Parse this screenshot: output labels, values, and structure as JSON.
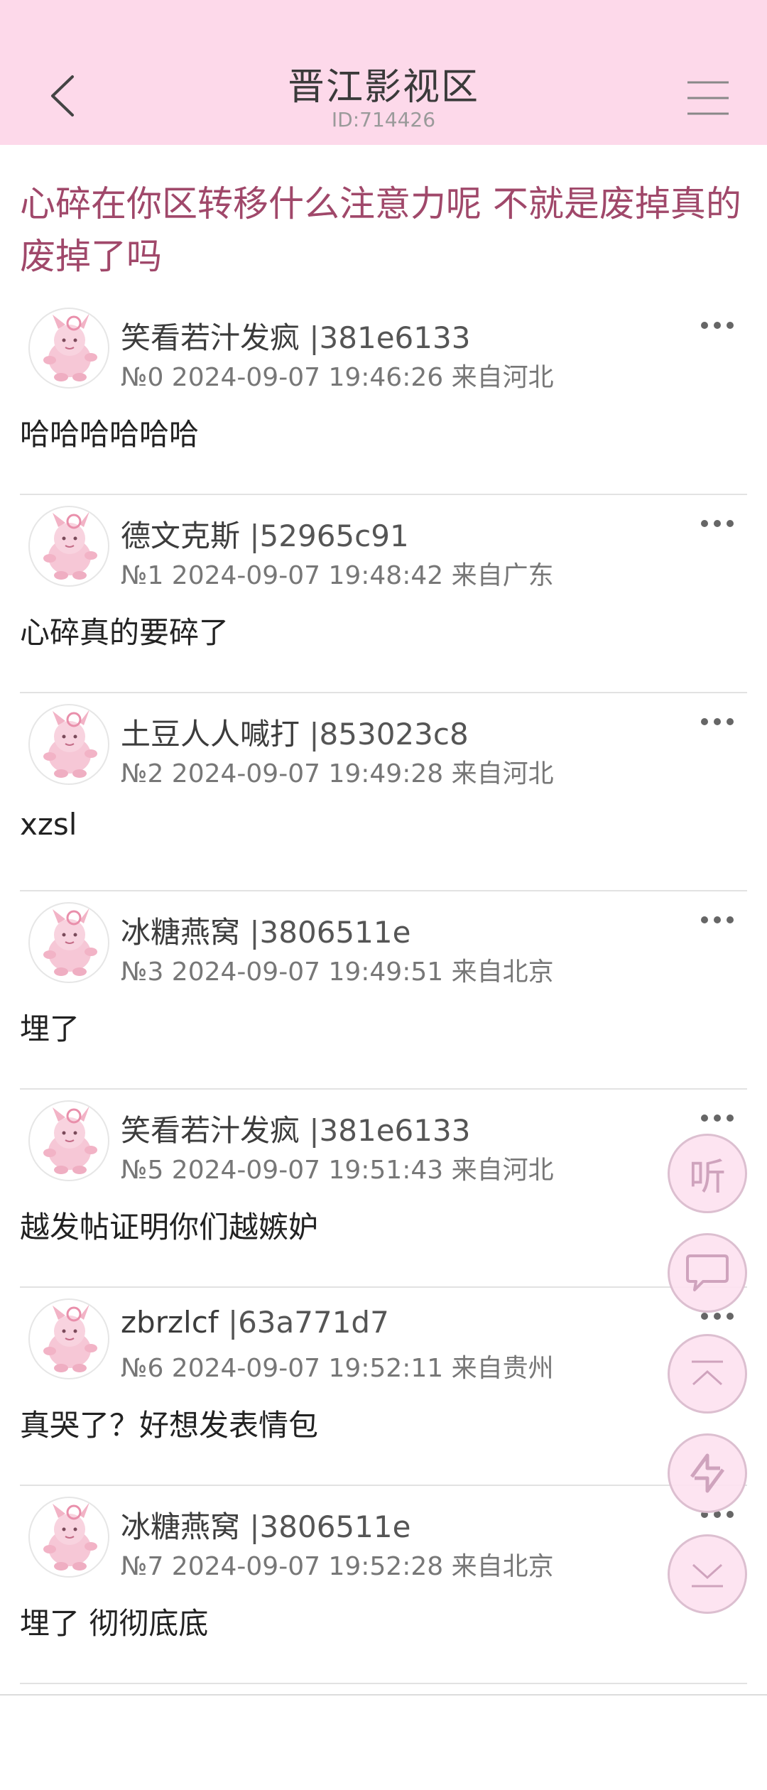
{
  "header": {
    "title": "晋江影视区",
    "id_label": "ID:714426",
    "background": "#fdd9ea"
  },
  "thread": {
    "title": "心碎在你区转移什么注意力呢 不就是废掉真的废掉了吗",
    "title_color": "#a0486a"
  },
  "posts": [
    {
      "author": "笑看若汁发疯",
      "uid": "|381e6133",
      "meta": "№0 2024-09-07 19:46:26 来自河北",
      "body": "哈哈哈哈哈哈"
    },
    {
      "author": "德文克斯",
      "uid": "|52965c91",
      "meta": "№1 2024-09-07 19:48:42 来自广东",
      "body": "心碎真的要碎了"
    },
    {
      "author": "土豆人人喊打",
      "uid": "|853023c8",
      "meta": "№2 2024-09-07 19:49:28 来自河北",
      "body": "xzsl"
    },
    {
      "author": "冰糖燕窝",
      "uid": "|3806511e",
      "meta": "№3 2024-09-07 19:49:51 来自北京",
      "body": "埋了"
    },
    {
      "author": "笑看若汁发疯",
      "uid": "|381e6133",
      "meta": "№5 2024-09-07 19:51:43 来自河北",
      "body": "越发帖证明你们越嫉妒"
    },
    {
      "author": "zbrzlcf",
      "uid": "|63a771d7",
      "meta": "№6 2024-09-07 19:52:11 来自贵州",
      "body": "真哭了？好想发表情包"
    },
    {
      "author": "冰糖燕窝",
      "uid": "|3806511e",
      "meta": "№7 2024-09-07 19:52:28 来自北京",
      "body": "埋了 彻彻底底"
    }
  ],
  "floating": {
    "listen_label": "听",
    "icons": [
      "comment-icon",
      "scroll-top-icon",
      "refresh-icon",
      "scroll-bottom-icon"
    ]
  },
  "icons": {
    "back": "chevron-left-icon",
    "menu": "hamburger-menu-icon",
    "more": "more-dots-icon",
    "avatar": "pink-creature-avatar"
  }
}
